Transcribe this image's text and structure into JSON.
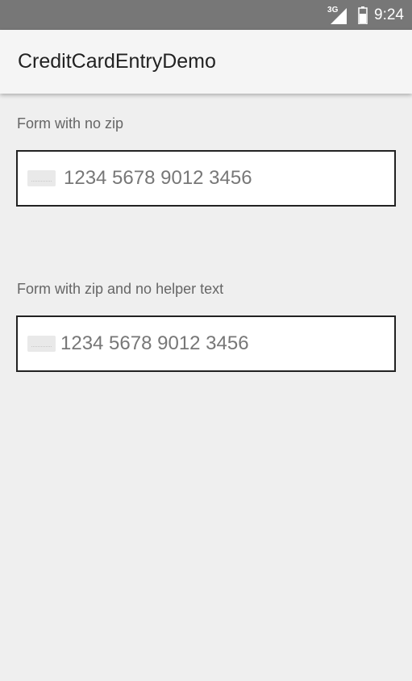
{
  "status_bar": {
    "network_type": "3G",
    "time": "9:24",
    "icons": [
      "signal-icon",
      "battery-icon"
    ]
  },
  "app_bar": {
    "title": "CreditCardEntryDemo"
  },
  "forms": [
    {
      "label": "Form with no zip",
      "card_number_placeholder": "1234 5678 9012 3456",
      "icon": "credit-card-icon"
    },
    {
      "label": "Form with zip and no helper text",
      "card_number_placeholder": "1234 5678 9012 3456",
      "icon": "credit-card-icon"
    }
  ],
  "colors": {
    "status_bar": "#777777",
    "app_bar": "#f5f5f5",
    "background": "#efefef",
    "field_border": "#222222"
  }
}
